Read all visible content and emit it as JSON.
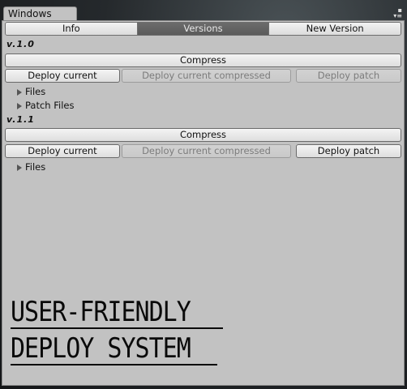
{
  "window": {
    "tab_title": "Windows",
    "menu_icon": "context-menu-icon"
  },
  "toolbar": {
    "tabs": [
      {
        "label": "Info",
        "active": false
      },
      {
        "label": "Versions",
        "active": true
      },
      {
        "label": "New Version",
        "active": false
      }
    ]
  },
  "versions": [
    {
      "label": "v.1.0",
      "compress_label": "Compress",
      "deploy_current_label": "Deploy current",
      "deploy_compressed_label": "Deploy current compressed",
      "deploy_patch_label": "Deploy patch",
      "deploy_compressed_enabled": false,
      "deploy_patch_enabled": false,
      "foldouts": [
        "Files",
        "Patch Files"
      ]
    },
    {
      "label": "v.1.1",
      "compress_label": "Compress",
      "deploy_current_label": "Deploy current",
      "deploy_compressed_label": "Deploy current compressed",
      "deploy_patch_label": "Deploy patch",
      "deploy_compressed_enabled": false,
      "deploy_patch_enabled": true,
      "foldouts": [
        "Files"
      ]
    }
  ],
  "promo": {
    "line1": "USER-FRIENDLY",
    "line2": "DEPLOY SYSTEM"
  },
  "colors": {
    "panel_bg": "#c2c2c2",
    "active_tab": "#5a5a5a",
    "disabled_text": "#7c7c7c"
  }
}
